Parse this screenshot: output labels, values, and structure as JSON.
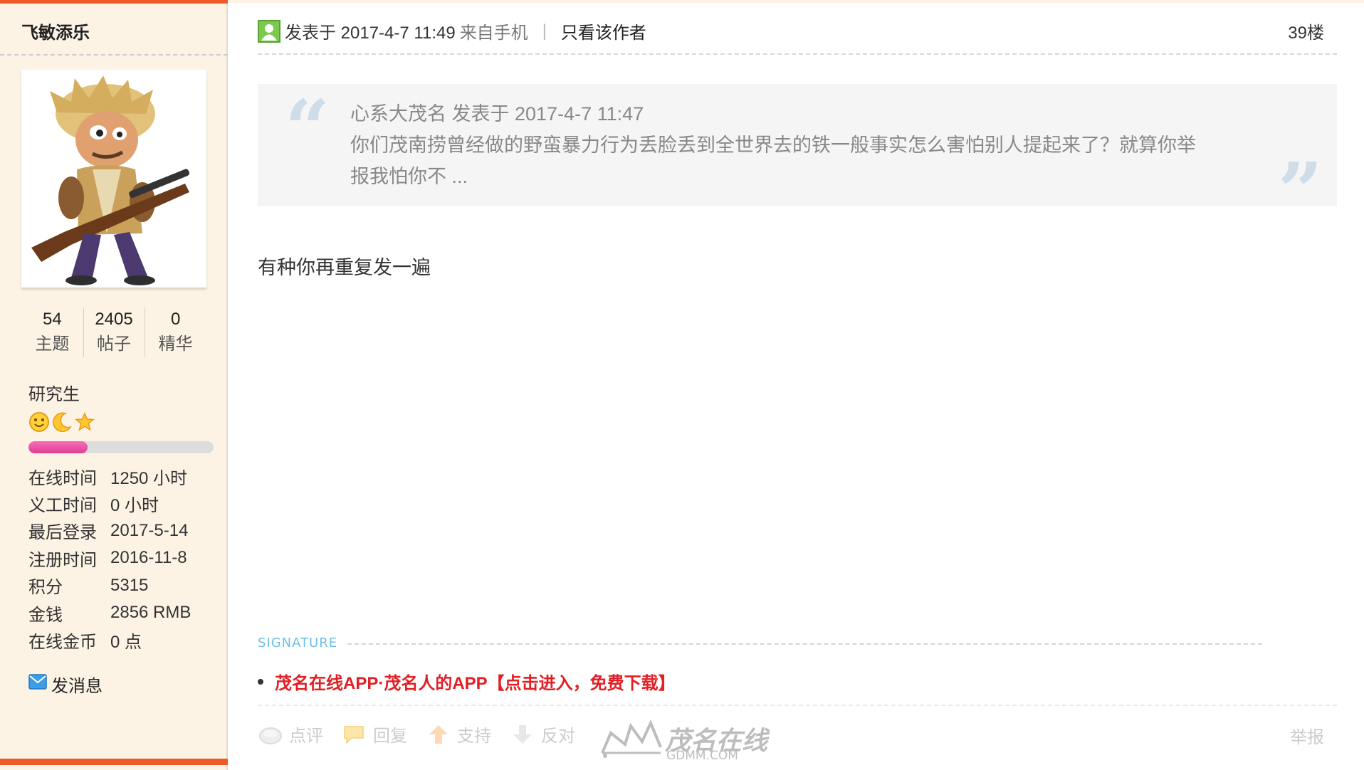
{
  "user": {
    "name": "飞敏添乐",
    "stats": [
      {
        "value": "54",
        "label": "主题"
      },
      {
        "value": "2405",
        "label": "帖子"
      },
      {
        "value": "0",
        "label": "精华"
      }
    ],
    "rank": "研究生",
    "rank_icons": [
      "smile-icon",
      "moon-icon",
      "star-icon"
    ],
    "level_progress": 0.32,
    "info": [
      {
        "key": "在线时间",
        "value": "1250 小时"
      },
      {
        "key": "义工时间",
        "value": "0 小时"
      },
      {
        "key": "最后登录",
        "value": "2017-5-14"
      },
      {
        "key": "注册时间",
        "value": "2016-11-8"
      },
      {
        "key": "积分",
        "value": "5315"
      },
      {
        "key": "金钱",
        "value": "2856 RMB"
      },
      {
        "key": "在线金币",
        "value": "0 点"
      }
    ],
    "send_message": "发消息"
  },
  "post": {
    "meta": "发表于 2017-4-7 11:49",
    "from": "来自手机",
    "separator": "|",
    "only_author": "只看该作者",
    "floor": "39楼",
    "quote": {
      "line1": "心系大茂名 发表于 2017-4-7 11:47",
      "line2": "你们茂南捞曾经做的野蛮暴力行为丢脸丢到全世界去的铁一般事实怎么害怕别人提起来了？就算你举",
      "line3": "报我怕你不 ..."
    },
    "body": "有种你再重复发一遍",
    "signature_label": "SIGNATURE",
    "signature_link": "茂名在线APP·茂名人的APP【点击进入，免费下载】"
  },
  "actions": {
    "comment": "点评",
    "reply": "回复",
    "support": "支持",
    "oppose": "反对",
    "report": "举报"
  },
  "watermark": {
    "text": "茂名在线",
    "sub": "GDMM.COM"
  },
  "colors": {
    "accent": "#f05a28",
    "sidebar_bg": "#fcf3e5",
    "signature_link": "#e31e24",
    "level_fill": "#e03c92"
  }
}
